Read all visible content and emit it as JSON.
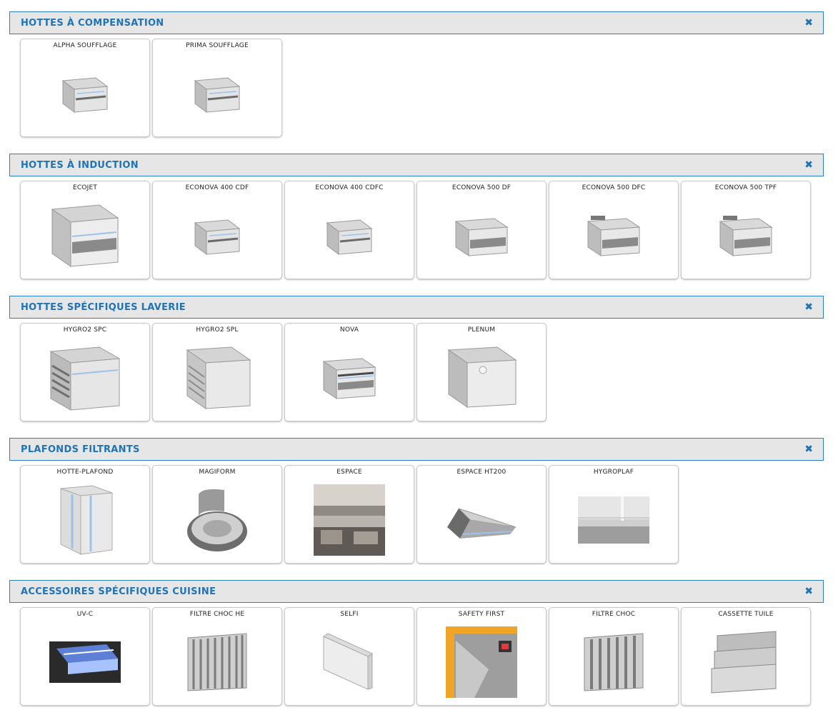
{
  "sections": [
    {
      "title": "HOTTES À COMPENSATION",
      "close_glyph": "✖",
      "items": [
        {
          "label": "ALPHA SOUFFLAGE",
          "image": "hood-icon"
        },
        {
          "label": "PRIMA SOUFFLAGE",
          "image": "hood-icon"
        }
      ]
    },
    {
      "title": "HOTTES À INDUCTION",
      "close_glyph": "✖",
      "items": [
        {
          "label": "ECOJET",
          "image": "hood-icon"
        },
        {
          "label": "ECONOVA 400 CDF",
          "image": "hood-icon"
        },
        {
          "label": "ECONOVA 400 CDFC",
          "image": "hood-icon"
        },
        {
          "label": "ECONOVA 500 DF",
          "image": "hood-icon"
        },
        {
          "label": "ECONOVA 500 DFC",
          "image": "hood-icon"
        },
        {
          "label": "ECONOVA 500 TPF",
          "image": "hood-icon"
        }
      ]
    },
    {
      "title": "HOTTES SPÉCIFIQUES LAVERIE",
      "close_glyph": "✖",
      "items": [
        {
          "label": "HYGRO2 SPC",
          "image": "louvered-hood-icon"
        },
        {
          "label": "HYGRO2 SPL",
          "image": "louvered-hood-icon"
        },
        {
          "label": "NOVA",
          "image": "hood-icon"
        },
        {
          "label": "PLENUM",
          "image": "plenum-icon"
        }
      ]
    },
    {
      "title": "PLAFONDS FILTRANTS",
      "close_glyph": "✖",
      "items": [
        {
          "label": "HOTTE-PLAFOND",
          "image": "ceiling-panel-icon"
        },
        {
          "label": "MAGIFORM",
          "image": "oval-hood-icon"
        },
        {
          "label": "ESPACE",
          "image": "kitchen-photo-icon"
        },
        {
          "label": "ESPACE HT200",
          "image": "ceiling-hood-icon"
        },
        {
          "label": "HYGROPLAF",
          "image": "ceiling-photo-icon"
        }
      ]
    },
    {
      "title": "ACCESSOIRES SPÉCIFIQUES CUISINE",
      "close_glyph": "✖",
      "items": [
        {
          "label": "UV-C",
          "image": "uv-lamp-icon"
        },
        {
          "label": "FILTRE CHOC HE",
          "image": "baffle-filter-icon"
        },
        {
          "label": "SELFI",
          "image": "selfi-panel-icon"
        },
        {
          "label": "SAFETY FIRST",
          "image": "safety-photo-icon"
        },
        {
          "label": "FILTRE CHOC",
          "image": "baffle-filter-icon"
        },
        {
          "label": "CASSETTE TUILE",
          "image": "tile-cassette-icon"
        }
      ]
    }
  ]
}
